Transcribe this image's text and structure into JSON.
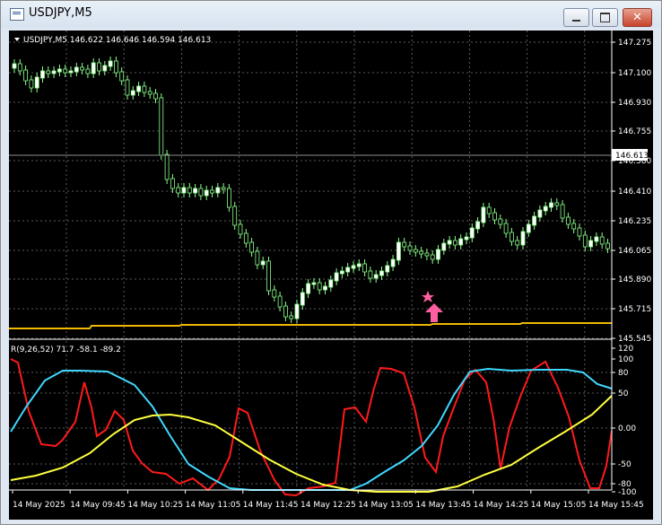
{
  "window": {
    "title": "USDJPY,M5"
  },
  "price_panel": {
    "header": "USDJPY,M5  146.622 146.646 146.594 146.613",
    "current_price_tag": "146.613",
    "y_ticks": [
      "147.275",
      "147.100",
      "146.930",
      "146.755",
      "146.580",
      "146.410",
      "146.235",
      "146.065",
      "145.890",
      "145.715",
      "145.545"
    ]
  },
  "indicator_panel": {
    "header": "R(9,26,52) 71.7 -58.1 -89.2",
    "y_ticks": [
      "120",
      "100",
      "80",
      "50",
      "0.00",
      "-50",
      "-80",
      "-100"
    ]
  },
  "time_axis": [
    "14 May 2025",
    "14 May 09:45",
    "14 May 10:25",
    "14 May 11:05",
    "14 May 11:45",
    "14 May 12:25",
    "14 May 13:05",
    "14 May 13:45",
    "14 May 14:25",
    "14 May 15:05",
    "14 May 15:45"
  ],
  "colors": {
    "background": "#000000",
    "candle": "#8aff8a",
    "ma_line": "#f0b800",
    "arrow": "#ff5fa0",
    "red_line": "#ff1a1a",
    "cyan_line": "#40d8ff",
    "yellow_line": "#ffff40"
  },
  "icons": {
    "signal_star": "star-icon",
    "signal_arrow": "up-arrow-icon"
  },
  "chart_data": {
    "type": "line",
    "title": "USDJPY,M5",
    "price_ylim": [
      145.545,
      147.275
    ],
    "indicator_ylim": [
      -100,
      120
    ],
    "ohlc_last": {
      "open": 146.622,
      "high": 146.646,
      "low": 146.594,
      "close": 146.613
    },
    "indicator_last": {
      "red": 71.7,
      "cyan": -58.1,
      "yellow": -89.2
    }
  }
}
